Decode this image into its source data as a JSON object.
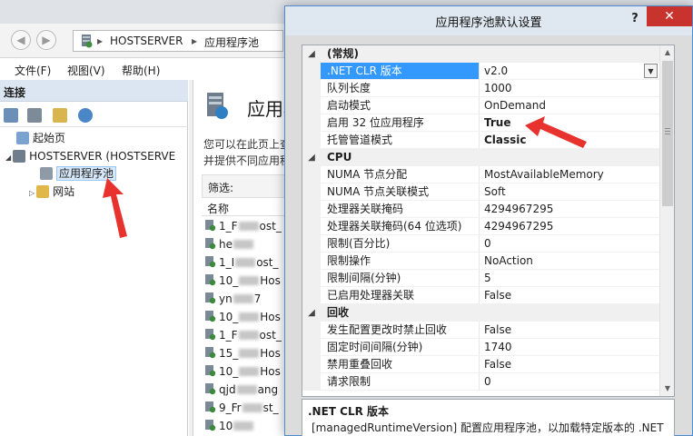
{
  "address": {
    "crumbs": [
      "HOSTSERVER",
      "应用程序池"
    ],
    "separator": "▸"
  },
  "menu": [
    "文件(F)",
    "视图(V)",
    "帮助(H)"
  ],
  "connections": {
    "heading": "连接",
    "tree": [
      {
        "label": "起始页"
      },
      {
        "label": "HOSTSERVER (HOSTSERVE"
      },
      {
        "label": "应用程序池"
      },
      {
        "label": "网站"
      }
    ]
  },
  "center": {
    "title": "应用程",
    "desc_lines": [
      "您可以在此页上查",
      "并提供不同应用程"
    ],
    "filter_label": "筛选:",
    "column_name": "名称",
    "pools": [
      {
        "a": "1_F",
        "b": "ost_"
      },
      {
        "a": "he",
        "b": ""
      },
      {
        "a": "1_I",
        "b": "ost_"
      },
      {
        "a": "10_",
        "b": "Hos"
      },
      {
        "a": "yn",
        "b": "7"
      },
      {
        "a": "10_",
        "b": "Hos"
      },
      {
        "a": "1_F",
        "b": "ost_"
      },
      {
        "a": "15_",
        "b": "Hos"
      },
      {
        "a": "10_",
        "b": "Hos"
      },
      {
        "a": "qjd",
        "b": "ang"
      },
      {
        "a": "9_Fr",
        "b": "st_"
      },
      {
        "a": "10",
        "b": ""
      }
    ]
  },
  "dialog": {
    "title": "应用程序池默认设置",
    "help": "?",
    "close": "✕",
    "rows": [
      {
        "type": "cat",
        "name": "(常规)"
      },
      {
        "type": "prop",
        "name": ".NET CLR 版本",
        "value": "v2.0",
        "selected": true,
        "dropdown": true
      },
      {
        "type": "prop",
        "name": "队列长度",
        "value": "1000"
      },
      {
        "type": "prop",
        "name": "启动模式",
        "value": "OnDemand"
      },
      {
        "type": "prop",
        "name": "启用 32 位应用程序",
        "value": "True",
        "bold": true
      },
      {
        "type": "prop",
        "name": "托管管道模式",
        "value": "Classic",
        "bold": true
      },
      {
        "type": "cat",
        "name": "CPU"
      },
      {
        "type": "prop",
        "name": "NUMA 节点分配",
        "value": "MostAvailableMemory"
      },
      {
        "type": "prop",
        "name": "NUMA 节点关联模式",
        "value": "Soft"
      },
      {
        "type": "prop",
        "name": "处理器关联掩码",
        "value": "4294967295"
      },
      {
        "type": "prop",
        "name": "处理器关联掩码(64 位选项)",
        "value": "4294967295"
      },
      {
        "type": "prop",
        "name": "限制(百分比)",
        "value": "0"
      },
      {
        "type": "prop",
        "name": "限制操作",
        "value": "NoAction"
      },
      {
        "type": "prop",
        "name": "限制间隔(分钟)",
        "value": "5"
      },
      {
        "type": "prop",
        "name": "已启用处理器关联",
        "value": "False"
      },
      {
        "type": "cat",
        "name": "回收"
      },
      {
        "type": "prop",
        "name": "发生配置更改时禁止回收",
        "value": "False"
      },
      {
        "type": "prop",
        "name": "固定时间间隔(分钟)",
        "value": "1740"
      },
      {
        "type": "prop",
        "name": "禁用重叠回收",
        "value": "False"
      },
      {
        "type": "prop",
        "name": "请求限制",
        "value": "0"
      }
    ],
    "desc_title": ".NET CLR 版本",
    "desc_text": "[managedRuntimeVersion] 配置应用程序池，以加载特定版本的 .NET"
  },
  "colors": {
    "selection": "#3399ff",
    "close_button": "#c8332e",
    "annotation_arrow": "#e8322e"
  },
  "icons": [
    "back-icon",
    "forward-icon",
    "server-icon",
    "start-page-icon",
    "app-pool-icon",
    "sites-icon",
    "expand-icon",
    "collapse-icon",
    "dropdown-icon",
    "help-icon",
    "close-icon"
  ]
}
